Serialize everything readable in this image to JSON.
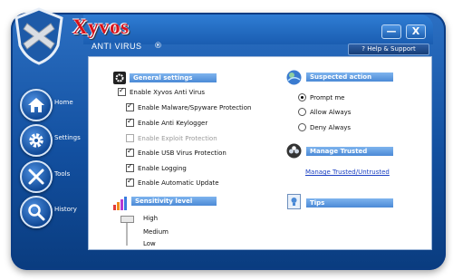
{
  "app": {
    "title": "Xyvos",
    "subtitle": "ANTI VIRUS",
    "reg_mark": "®"
  },
  "window": {
    "minimize": "—",
    "close": "X",
    "help": "? Help & Support"
  },
  "sidebar": {
    "items": [
      {
        "label": "Home",
        "icon": "home-icon"
      },
      {
        "label": "Settings",
        "icon": "gear-icon"
      },
      {
        "label": "Tools",
        "icon": "tools-icon"
      },
      {
        "label": "History",
        "icon": "magnifier-icon"
      }
    ]
  },
  "general": {
    "header": "General settings",
    "enable_main": {
      "label": "Enable Xyvos Anti Virus",
      "checked": true
    },
    "options": [
      {
        "label": "Enable Malware/Spyware Protection",
        "checked": true,
        "enabled": true
      },
      {
        "label": "Enable Anti Keylogger",
        "checked": true,
        "enabled": true
      },
      {
        "label": "Enable Exploit Protection",
        "checked": false,
        "enabled": false
      },
      {
        "label": "Enable USB Virus Protection",
        "checked": true,
        "enabled": true
      },
      {
        "label": "Enable Logging",
        "checked": true,
        "enabled": true
      },
      {
        "label": "Enable Automatic Update",
        "checked": true,
        "enabled": true
      }
    ]
  },
  "sensitivity": {
    "header": "Sensitivity level",
    "levels": [
      "High",
      "Medium",
      "Low"
    ],
    "selected": "High"
  },
  "suspected": {
    "header": "Suspected action",
    "options": [
      {
        "label": "Prompt me",
        "selected": true
      },
      {
        "label": "Allow Always",
        "selected": false
      },
      {
        "label": "Deny Always",
        "selected": false
      }
    ]
  },
  "trusted": {
    "header": "Manage Trusted",
    "link": "Manage Trusted/Untrusted"
  },
  "tips": {
    "header": "Tips"
  },
  "colors": {
    "brand_red": "#d9121a",
    "window_blue": "#124f9f",
    "header_blue": "#4b8ad6",
    "link_blue": "#1a3fc2"
  }
}
